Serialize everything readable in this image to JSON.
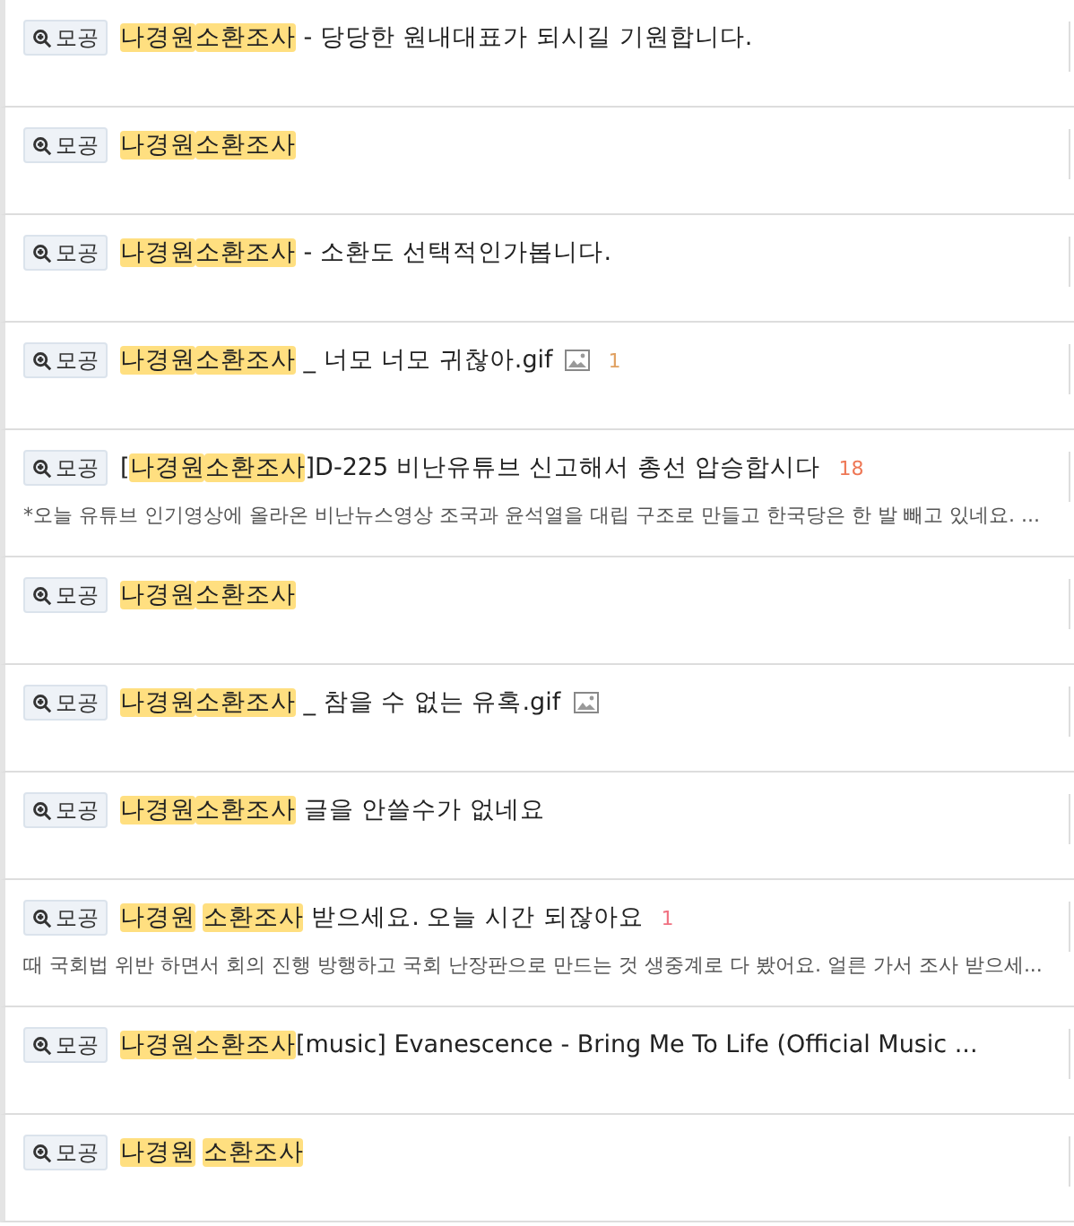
{
  "posts": [
    {
      "tag": "모공",
      "title": [
        {
          "text": "나경원",
          "kind": "highlight"
        },
        {
          "text": "소환조사",
          "kind": "highlight"
        },
        {
          "text": " - 당당한 원내대표가 되시길 기원합니다.",
          "kind": "plain"
        }
      ],
      "has_image": false
    },
    {
      "tag": "모공",
      "title": [
        {
          "text": "나경원",
          "kind": "highlight"
        },
        {
          "text": "소환조사",
          "kind": "highlight"
        }
      ],
      "has_image": false
    },
    {
      "tag": "모공",
      "title": [
        {
          "text": "나경원",
          "kind": "highlight"
        },
        {
          "text": "소환조사",
          "kind": "highlight"
        },
        {
          "text": " - 소환도 선택적인가봅니다.",
          "kind": "plain"
        }
      ],
      "has_image": false
    },
    {
      "tag": "모공",
      "title": [
        {
          "text": "나경원",
          "kind": "highlight"
        },
        {
          "text": "소환조사",
          "kind": "highlight"
        },
        {
          "text": " _ 너모 너모 귀찮아.gif",
          "kind": "plain"
        }
      ],
      "has_image": true,
      "comments": {
        "count": "1",
        "color": "#e0a060"
      }
    },
    {
      "tag": "모공",
      "title": [
        {
          "text": "[",
          "kind": "plain"
        },
        {
          "text": "나경원",
          "kind": "highlight"
        },
        {
          "text": "소환조사",
          "kind": "highlight"
        },
        {
          "text": "]D-225 비난유튜브 신고해서 총선 압승합시다",
          "kind": "plain"
        }
      ],
      "has_image": false,
      "comments": {
        "count": "18",
        "color": "#ee7755"
      },
      "excerpt": "*오늘 유튜브 인기영상에 올라온 비난뉴스영상 조국과 윤석열을 대립 구조로 만들고 한국당은 한 발 빼고 있네요. ..."
    },
    {
      "tag": "모공",
      "title": [
        {
          "text": "나경원",
          "kind": "highlight"
        },
        {
          "text": "소환조사",
          "kind": "highlight"
        }
      ],
      "has_image": false
    },
    {
      "tag": "모공",
      "title": [
        {
          "text": "나경원",
          "kind": "highlight"
        },
        {
          "text": "소환조사",
          "kind": "highlight"
        },
        {
          "text": " _ 참을 수 없는 유혹.gif",
          "kind": "plain"
        }
      ],
      "has_image": true
    },
    {
      "tag": "모공",
      "title": [
        {
          "text": "나경원",
          "kind": "highlight"
        },
        {
          "text": "소환조사",
          "kind": "highlight"
        },
        {
          "text": " 글을 안쓸수가 없네요",
          "kind": "plain"
        }
      ],
      "has_image": false
    },
    {
      "tag": "모공",
      "title": [
        {
          "text": "나경원 ",
          "kind": "highlight"
        },
        {
          "text": "소환조사",
          "kind": "highlight"
        },
        {
          "text": " 받으세요. 오늘 시간 되잖아요",
          "kind": "plain"
        }
      ],
      "has_image": false,
      "comments": {
        "count": "1",
        "color": "#f07080"
      },
      "excerpt": "때 국회법 위반 하면서 회의 진행 방행하고 국회 난장판으로 만드는 것 생중계로 다 봤어요. 얼른 가서 조사 받으세..."
    },
    {
      "tag": "모공",
      "title": [
        {
          "text": "나경원",
          "kind": "highlight"
        },
        {
          "text": "소환조사",
          "kind": "highlight"
        },
        {
          "text": "[music] Evanescence - Bring Me To Life (Official Music ...",
          "kind": "plain"
        }
      ],
      "has_image": false
    },
    {
      "tag": "모공",
      "title": [
        {
          "text": "나경원 ",
          "kind": "highlight"
        },
        {
          "text": "소환조사",
          "kind": "highlight"
        }
      ],
      "has_image": false
    }
  ]
}
